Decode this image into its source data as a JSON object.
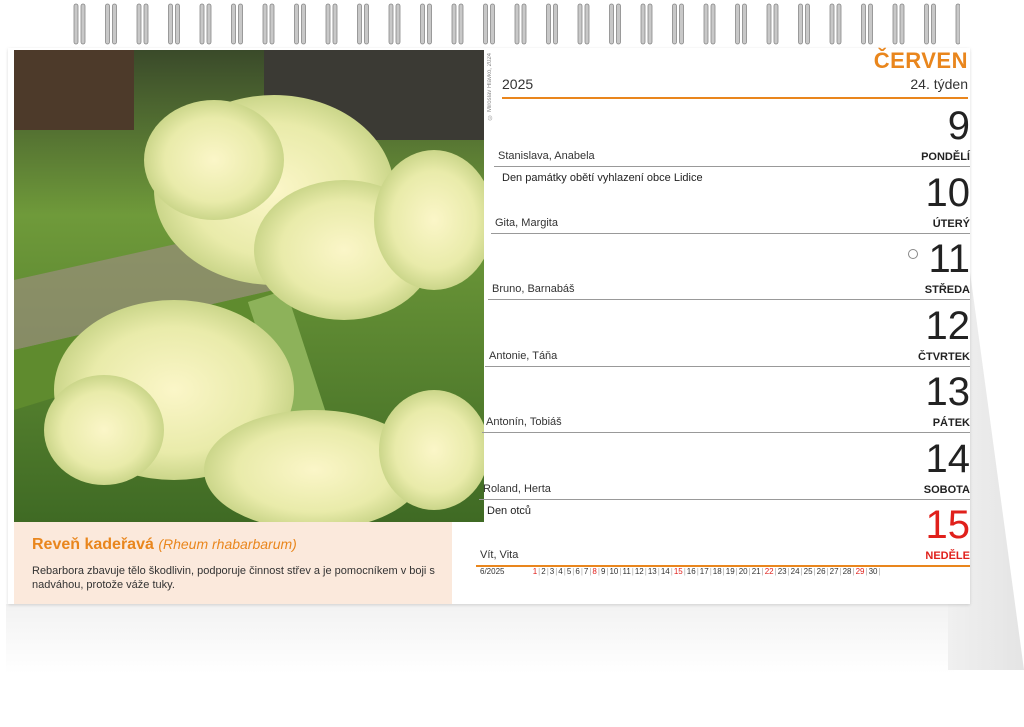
{
  "calendar": {
    "month": "ČERVEN",
    "year": "2025",
    "week": "24. týden",
    "credit": "© Miroslav Hlávko, 2024",
    "caption": {
      "title": "Reveň kadeřavá",
      "latin": "(Rheum rhabarbarum)",
      "text": "Rebarbora zbavuje tělo škodlivin, podporuje činnost střev a je pomocníkem v boji s nadváhou, protože váže tuky."
    },
    "days": [
      {
        "num": "9",
        "name": "PONDĚLÍ",
        "names": "Stanislava, Anabela",
        "holiday": "Den památky obětí vyhlazení obce Lidice"
      },
      {
        "num": "10",
        "name": "ÚTERÝ",
        "names": "Gita, Margita",
        "holiday": ""
      },
      {
        "num": "11",
        "name": "STŘEDA",
        "names": "Bruno, Barnabáš",
        "holiday": ""
      },
      {
        "num": "12",
        "name": "ČTVRTEK",
        "names": "Antonie, Táňa",
        "holiday": ""
      },
      {
        "num": "13",
        "name": "PÁTEK",
        "names": "Antonín, Tobiáš",
        "holiday": ""
      },
      {
        "num": "14",
        "name": "SOBOTA",
        "names": "Roland, Herta",
        "holiday": "Den otců"
      },
      {
        "num": "15",
        "name": "NEDĚLE",
        "names": "Vít, Vita",
        "holiday": ""
      }
    ],
    "strip": {
      "label": "6/2025",
      "days": [
        "1",
        "2",
        "3",
        "4",
        "5",
        "6",
        "7",
        "8",
        "9",
        "10",
        "11",
        "12",
        "13",
        "14",
        "15",
        "16",
        "17",
        "18",
        "19",
        "20",
        "21",
        "22",
        "23",
        "24",
        "25",
        "26",
        "27",
        "28",
        "29",
        "30"
      ],
      "red_days": [
        "1",
        "8",
        "15",
        "22",
        "29"
      ]
    },
    "colors": {
      "accent": "#e9861d",
      "sunday": "#e0201b"
    }
  }
}
